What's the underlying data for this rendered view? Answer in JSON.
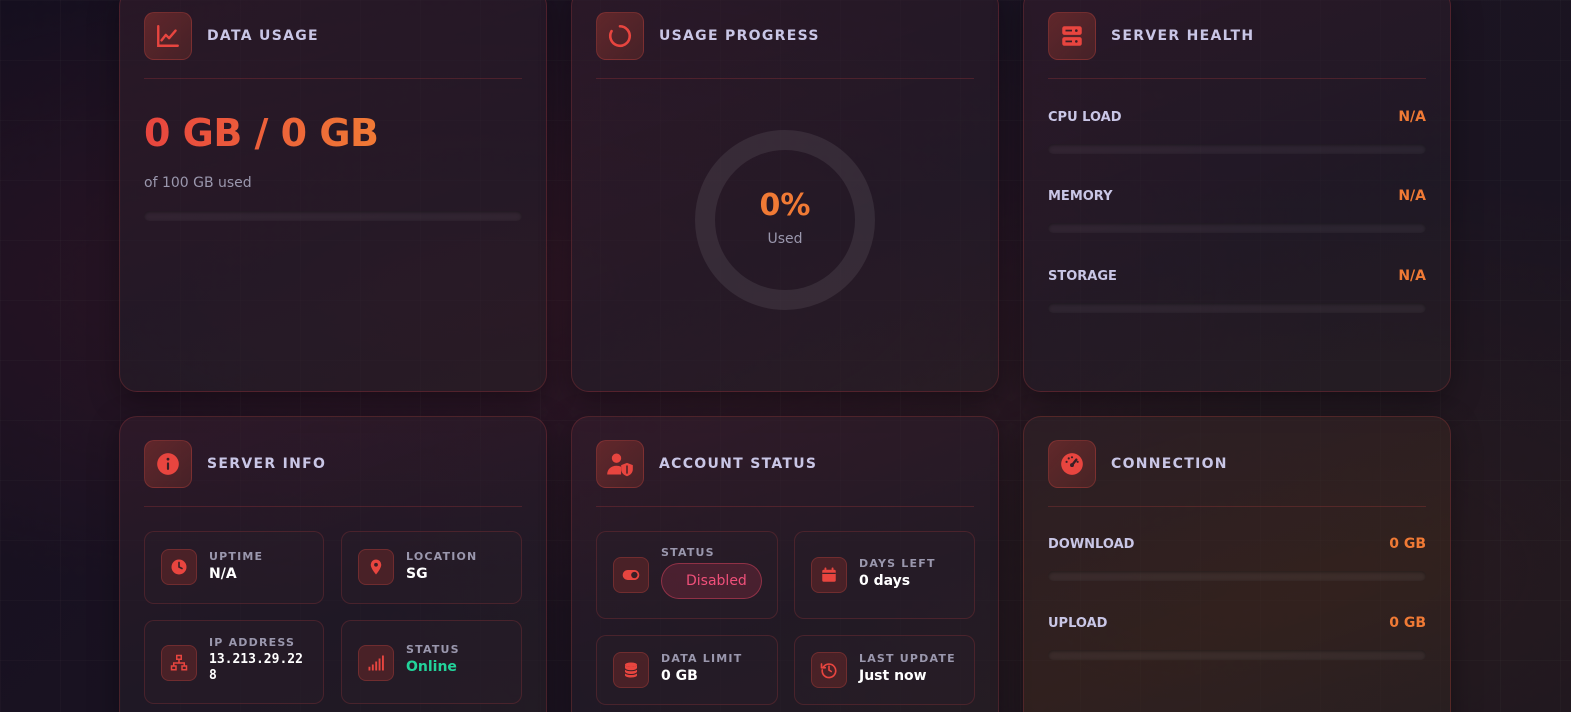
{
  "colors": {
    "accent_red": "#e8453f",
    "accent_orange": "#f07a35",
    "online_green": "#22d39a",
    "disabled_pink": "#f0507a"
  },
  "data_usage": {
    "title": "DATA USAGE",
    "icon": "line-chart-icon",
    "used_text": "0 GB / 0 GB",
    "sub_text": "of 100 GB used",
    "progress_fraction": 0
  },
  "usage_progress": {
    "title": "USAGE PROGRESS",
    "icon": "circle-notch-icon",
    "percent_text": "0%",
    "label": "Used",
    "progress_fraction": 0
  },
  "server_health": {
    "title": "SERVER HEALTH",
    "icon": "server-icon",
    "metrics": [
      {
        "label": "CPU LOAD",
        "value": "N/A",
        "fraction": 0
      },
      {
        "label": "MEMORY",
        "value": "N/A",
        "fraction": 0
      },
      {
        "label": "STORAGE",
        "value": "N/A",
        "fraction": 0
      }
    ]
  },
  "server_info": {
    "title": "SERVER INFO",
    "icon": "info-icon",
    "tiles": [
      {
        "label": "UPTIME",
        "value": "N/A",
        "icon": "clock-icon"
      },
      {
        "label": "LOCATION",
        "value": "SG",
        "icon": "map-pin-icon"
      },
      {
        "label": "IP ADDRESS",
        "value": "13.213.29.228",
        "icon": "network-icon"
      },
      {
        "label": "STATUS",
        "value": "Online",
        "icon": "signal-bars-icon"
      }
    ]
  },
  "account_status": {
    "title": "ACCOUNT STATUS",
    "icon": "user-shield-icon",
    "tiles": [
      {
        "label": "STATUS",
        "value": "Disabled",
        "icon": "toggle-icon"
      },
      {
        "label": "DAYS LEFT",
        "value": "0 days",
        "icon": "calendar-icon"
      },
      {
        "label": "DATA LIMIT",
        "value": "0 GB",
        "icon": "database-icon"
      },
      {
        "label": "LAST UPDATE",
        "value": "Just now",
        "icon": "history-icon"
      }
    ]
  },
  "connection": {
    "title": "CONNECTION",
    "icon": "gauge-icon",
    "metrics": [
      {
        "label": "DOWNLOAD",
        "value": "0 GB",
        "fraction": 0
      },
      {
        "label": "UPLOAD",
        "value": "0 GB",
        "fraction": 0
      }
    ]
  }
}
